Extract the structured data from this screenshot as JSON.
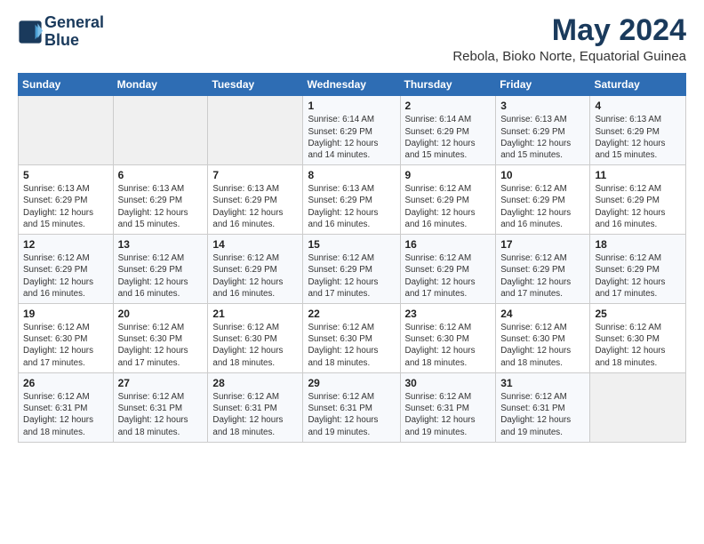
{
  "header": {
    "logo_line1": "General",
    "logo_line2": "Blue",
    "main_title": "May 2024",
    "subtitle": "Rebola, Bioko Norte, Equatorial Guinea"
  },
  "calendar": {
    "headers": [
      "Sunday",
      "Monday",
      "Tuesday",
      "Wednesday",
      "Thursday",
      "Friday",
      "Saturday"
    ],
    "weeks": [
      [
        {
          "day": "",
          "info": ""
        },
        {
          "day": "",
          "info": ""
        },
        {
          "day": "",
          "info": ""
        },
        {
          "day": "1",
          "info": "Sunrise: 6:14 AM\nSunset: 6:29 PM\nDaylight: 12 hours\nand 14 minutes."
        },
        {
          "day": "2",
          "info": "Sunrise: 6:14 AM\nSunset: 6:29 PM\nDaylight: 12 hours\nand 15 minutes."
        },
        {
          "day": "3",
          "info": "Sunrise: 6:13 AM\nSunset: 6:29 PM\nDaylight: 12 hours\nand 15 minutes."
        },
        {
          "day": "4",
          "info": "Sunrise: 6:13 AM\nSunset: 6:29 PM\nDaylight: 12 hours\nand 15 minutes."
        }
      ],
      [
        {
          "day": "5",
          "info": "Sunrise: 6:13 AM\nSunset: 6:29 PM\nDaylight: 12 hours\nand 15 minutes."
        },
        {
          "day": "6",
          "info": "Sunrise: 6:13 AM\nSunset: 6:29 PM\nDaylight: 12 hours\nand 15 minutes."
        },
        {
          "day": "7",
          "info": "Sunrise: 6:13 AM\nSunset: 6:29 PM\nDaylight: 12 hours\nand 16 minutes."
        },
        {
          "day": "8",
          "info": "Sunrise: 6:13 AM\nSunset: 6:29 PM\nDaylight: 12 hours\nand 16 minutes."
        },
        {
          "day": "9",
          "info": "Sunrise: 6:12 AM\nSunset: 6:29 PM\nDaylight: 12 hours\nand 16 minutes."
        },
        {
          "day": "10",
          "info": "Sunrise: 6:12 AM\nSunset: 6:29 PM\nDaylight: 12 hours\nand 16 minutes."
        },
        {
          "day": "11",
          "info": "Sunrise: 6:12 AM\nSunset: 6:29 PM\nDaylight: 12 hours\nand 16 minutes."
        }
      ],
      [
        {
          "day": "12",
          "info": "Sunrise: 6:12 AM\nSunset: 6:29 PM\nDaylight: 12 hours\nand 16 minutes."
        },
        {
          "day": "13",
          "info": "Sunrise: 6:12 AM\nSunset: 6:29 PM\nDaylight: 12 hours\nand 16 minutes."
        },
        {
          "day": "14",
          "info": "Sunrise: 6:12 AM\nSunset: 6:29 PM\nDaylight: 12 hours\nand 16 minutes."
        },
        {
          "day": "15",
          "info": "Sunrise: 6:12 AM\nSunset: 6:29 PM\nDaylight: 12 hours\nand 17 minutes."
        },
        {
          "day": "16",
          "info": "Sunrise: 6:12 AM\nSunset: 6:29 PM\nDaylight: 12 hours\nand 17 minutes."
        },
        {
          "day": "17",
          "info": "Sunrise: 6:12 AM\nSunset: 6:29 PM\nDaylight: 12 hours\nand 17 minutes."
        },
        {
          "day": "18",
          "info": "Sunrise: 6:12 AM\nSunset: 6:29 PM\nDaylight: 12 hours\nand 17 minutes."
        }
      ],
      [
        {
          "day": "19",
          "info": "Sunrise: 6:12 AM\nSunset: 6:30 PM\nDaylight: 12 hours\nand 17 minutes."
        },
        {
          "day": "20",
          "info": "Sunrise: 6:12 AM\nSunset: 6:30 PM\nDaylight: 12 hours\nand 17 minutes."
        },
        {
          "day": "21",
          "info": "Sunrise: 6:12 AM\nSunset: 6:30 PM\nDaylight: 12 hours\nand 18 minutes."
        },
        {
          "day": "22",
          "info": "Sunrise: 6:12 AM\nSunset: 6:30 PM\nDaylight: 12 hours\nand 18 minutes."
        },
        {
          "day": "23",
          "info": "Sunrise: 6:12 AM\nSunset: 6:30 PM\nDaylight: 12 hours\nand 18 minutes."
        },
        {
          "day": "24",
          "info": "Sunrise: 6:12 AM\nSunset: 6:30 PM\nDaylight: 12 hours\nand 18 minutes."
        },
        {
          "day": "25",
          "info": "Sunrise: 6:12 AM\nSunset: 6:30 PM\nDaylight: 12 hours\nand 18 minutes."
        }
      ],
      [
        {
          "day": "26",
          "info": "Sunrise: 6:12 AM\nSunset: 6:31 PM\nDaylight: 12 hours\nand 18 minutes."
        },
        {
          "day": "27",
          "info": "Sunrise: 6:12 AM\nSunset: 6:31 PM\nDaylight: 12 hours\nand 18 minutes."
        },
        {
          "day": "28",
          "info": "Sunrise: 6:12 AM\nSunset: 6:31 PM\nDaylight: 12 hours\nand 18 minutes."
        },
        {
          "day": "29",
          "info": "Sunrise: 6:12 AM\nSunset: 6:31 PM\nDaylight: 12 hours\nand 19 minutes."
        },
        {
          "day": "30",
          "info": "Sunrise: 6:12 AM\nSunset: 6:31 PM\nDaylight: 12 hours\nand 19 minutes."
        },
        {
          "day": "31",
          "info": "Sunrise: 6:12 AM\nSunset: 6:31 PM\nDaylight: 12 hours\nand 19 minutes."
        },
        {
          "day": "",
          "info": ""
        }
      ]
    ]
  }
}
